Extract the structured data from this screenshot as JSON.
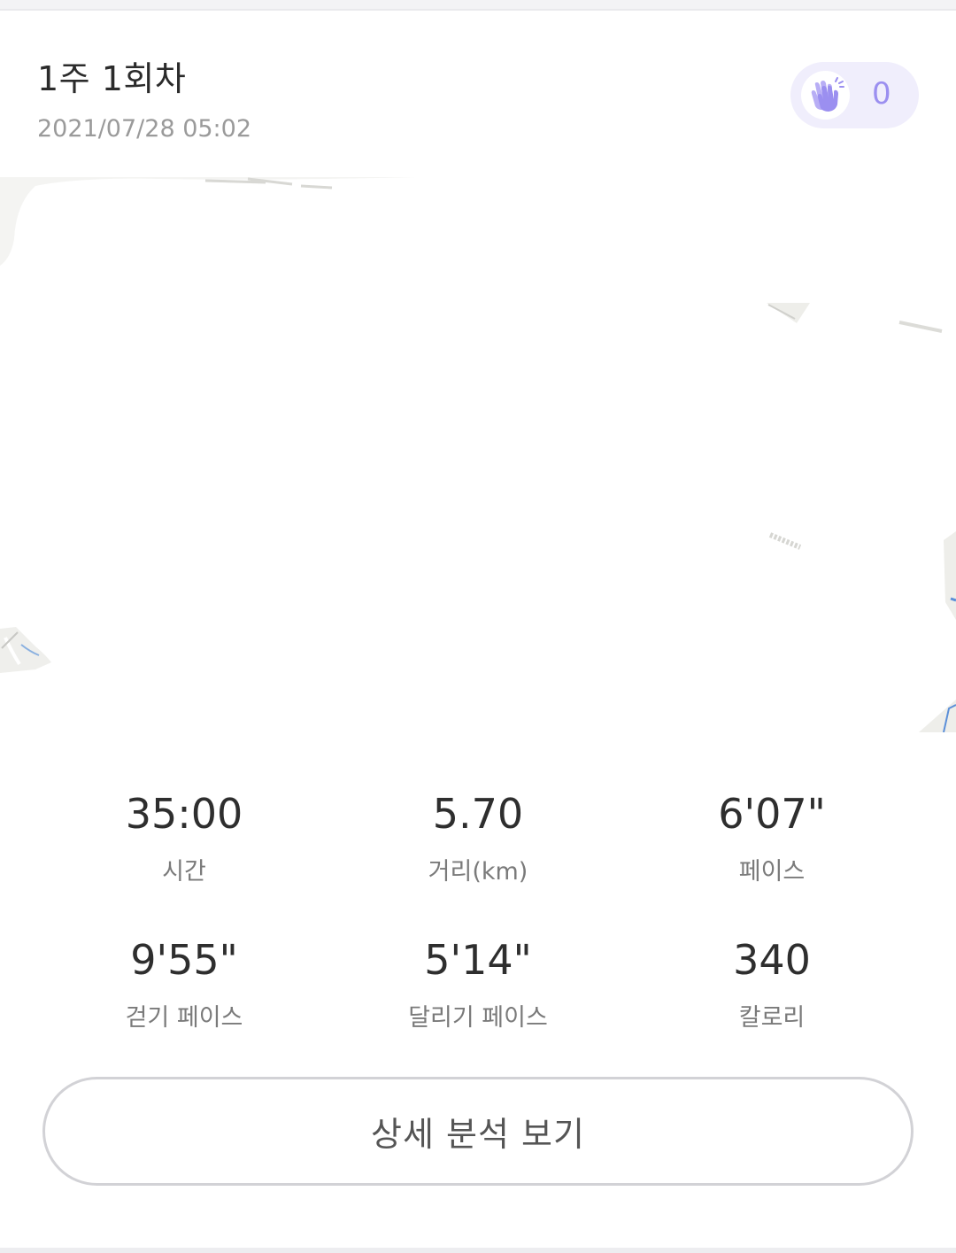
{
  "header": {
    "title": "1주 1회차",
    "datetime": "2021/07/28 05:02"
  },
  "clap": {
    "icon": "clap-hands-icon",
    "count": "0",
    "color": "#9b8ff0",
    "background": "#f0eefc"
  },
  "stats": [
    {
      "value": "35:00",
      "label": "시간"
    },
    {
      "value": "5.70",
      "label": "거리(km)"
    },
    {
      "value": "6'07\"",
      "label": "페이스"
    },
    {
      "value": "9'55\"",
      "label": "걷기 페이스"
    },
    {
      "value": "5'14\"",
      "label": "달리기 페이스"
    },
    {
      "value": "340",
      "label": "칼로리"
    }
  ],
  "detail_button": {
    "label": "상세 분석 보기"
  }
}
